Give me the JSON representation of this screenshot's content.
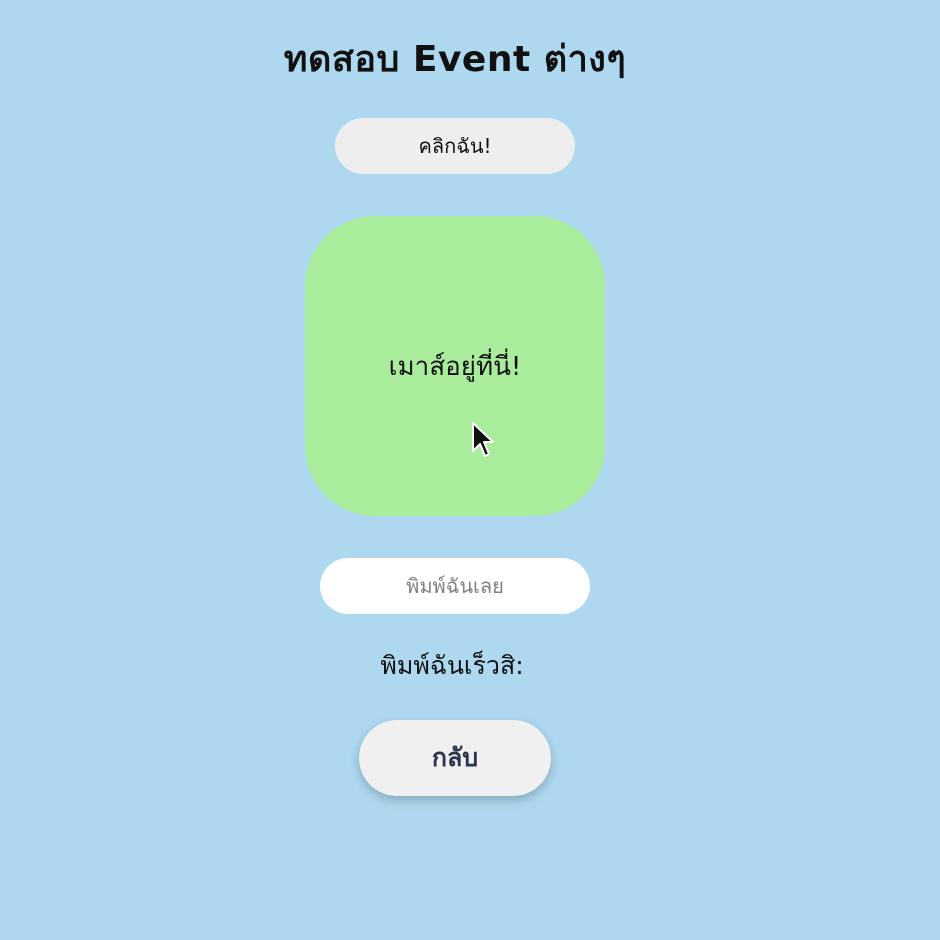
{
  "header": {
    "title": "ทดสอบ Event ต่างๆ"
  },
  "click_button": {
    "label": "คลิกฉัน!"
  },
  "hover_box": {
    "label": "เมาส์อยู่ที่นี่!",
    "color": "#a8ec9c"
  },
  "text_input": {
    "value": "",
    "placeholder": "พิมพ์ฉันเลย"
  },
  "echo": {
    "text": "พิมพ์ฉันเร็วสิ:"
  },
  "back_button": {
    "label": "กลับ"
  },
  "colors": {
    "background": "#add8ef",
    "button": "#eeeeee",
    "back_text": "#2b3550"
  },
  "icons": {
    "cursor": "mouse-pointer-icon"
  }
}
